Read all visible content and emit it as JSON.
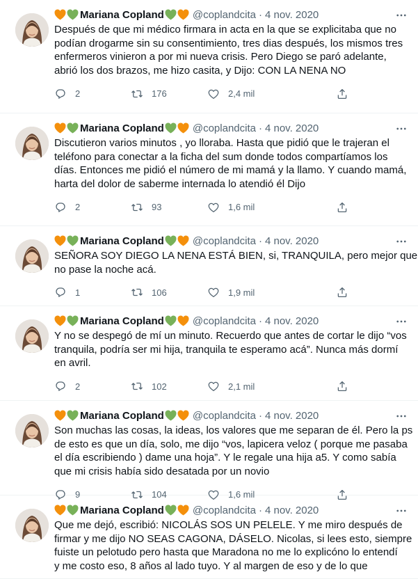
{
  "author": {
    "display_name": "Mariana Copland",
    "handle": "@coplandcita",
    "emoji_before": [
      "orange-heart",
      "green-heart"
    ],
    "emoji_after": [
      "green-heart",
      "orange-heart"
    ]
  },
  "colors": {
    "orange_heart": "#f4900c",
    "green_heart": "#78b159",
    "meta_text": "#536471",
    "body_text": "#0f1419",
    "divider": "#eff3f4"
  },
  "icons": {
    "reply": "reply-icon",
    "retweet": "retweet-icon",
    "like": "like-icon",
    "share": "share-icon",
    "more": "more-icon"
  },
  "tweets": [
    {
      "date": "4 nov. 2020",
      "lines": [
        "Después de que mi médico firmara in acta en la que se explicitaba que no",
        "podían drogarme sin su consentimiento, tres dias después, los mismos tres",
        "enfermeros vinieron a por mi nueva crisis. Pero Diego se paró adelante,",
        "abrió los dos brazos, me hizo casita, y Dijo: CON LA NENA NO"
      ],
      "replies": "2",
      "retweets": "176",
      "likes": "2,4 mil"
    },
    {
      "date": "4 nov. 2020",
      "lines": [
        "Discutieron varios minutos , yo lloraba. Hasta que pidió que le trajeran el",
        "teléfono para conectar a la ficha del sum donde todos compartíamos los",
        "días. Entonces me pidió el número de mi mamá y la llamo. Y cuando mamá,",
        "harta del dolor de saberme internada lo atendió él Dijo"
      ],
      "replies": "2",
      "retweets": "93",
      "likes": "1,6 mil"
    },
    {
      "date": "4 nov. 2020",
      "lines": [
        "SEÑORA SOY DIEGO LA NENA ESTÁ BIEN, si, TRANQUILA, pero mejor que",
        "no pase la noche acá."
      ],
      "replies": "1",
      "retweets": "106",
      "likes": "1,9 mil"
    },
    {
      "date": "4 nov. 2020",
      "lines": [
        "Y no se despegó de mí un minuto. Recuerdo que antes de cortar le dijo “vos",
        "tranquila, podría ser mi hija, tranquila te esperamo acá”. Nunca más dormí",
        "en avril."
      ],
      "replies": "2",
      "retweets": "102",
      "likes": "2,1 mil"
    },
    {
      "date": "4 nov. 2020",
      "lines": [
        "Son muchas las cosas, la ideas, los valores que me separan de él. Pero la ps",
        "de esto es que un día, solo, me dijo “vos, lapicera veloz ( porque me pasaba",
        "el día escribiendo ) dame una hoja”. Y le regale una hija a5. Y como sabía",
        "que mi crisis había sido desatada por un novio"
      ],
      "replies": "9",
      "retweets": "104",
      "likes": "1,6 mil"
    },
    {
      "date": "4 nov. 2020",
      "lines": [
        "Que me dejó, escribió: NICOLÁS SOS UN PELELE. Y me miro después de",
        "firmar y me dijo NO SEAS CAGONA, DÁSELO. Nicolas, si lees esto, siempre",
        "fuiste un pelotudo pero hasta que Maradona no me lo explicóno lo entendí",
        "y me costo eso, 8 años al lado tuyo. Y al margen de eso y de lo que"
      ],
      "replies": "",
      "retweets": "",
      "likes": ""
    }
  ]
}
